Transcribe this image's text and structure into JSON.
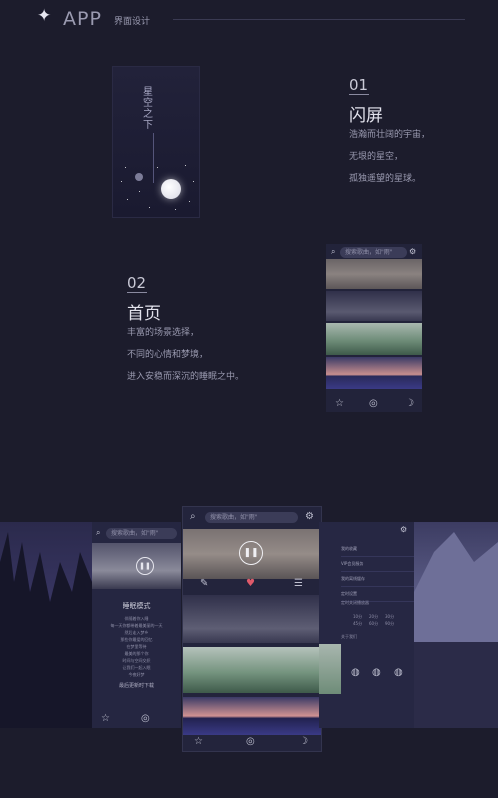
{
  "header": {
    "brand_icon": "sparkle-icon",
    "title": "APP",
    "subtitle": "界面设计"
  },
  "section1": {
    "number": "01",
    "title": "闪屏",
    "lines": [
      "浩瀚而壮阔的宇宙，",
      "无垠的星空，",
      "孤独遥望的星球。"
    ],
    "splash_calligraphy": "星空之下"
  },
  "section2": {
    "number": "02",
    "title": "首页",
    "lines": [
      "丰富的场景选择，",
      "不同的心情和梦境，",
      "进入安稳而深沉的睡眠之中。"
    ]
  },
  "home_phone": {
    "search_placeholder": "搜索歌曲，如\"雨\"",
    "nav": [
      "star-icon",
      "radio-icon",
      "moon-icon"
    ]
  },
  "center_phone": {
    "search_placeholder": "搜索歌曲，如\"雨\"",
    "player_icon": "pause-icon",
    "actions": [
      "edit-icon",
      "heart-icon",
      "menu-icon"
    ]
  },
  "left_phone": {
    "search_placeholder": "搜索歌曲，如\"雨\"",
    "title": "睡眠模式",
    "lines": [
      "伴随着你入睡",
      "每一天你都带着最美丽的一天",
      "然后走入梦乡",
      "那些你最爱的回忆",
      "在梦里等待",
      "最美的那个你",
      "时间与空间交织",
      "让我们一起入眠",
      "今夜好梦"
    ],
    "footer": "最后更新时下载"
  },
  "right_phone": {
    "menu": [
      "我的收藏",
      "VIP会员服务",
      "我的离线缓存",
      "定时设置"
    ],
    "sub_label": "定时关闭播放器",
    "times": [
      "10分",
      "20分",
      "30分",
      "45分",
      "60分",
      "90分"
    ],
    "about": "关于我们"
  },
  "colors": {
    "background": "#1c1c2c",
    "heart": "#e05a6a",
    "accent": "#c9c9d6"
  }
}
